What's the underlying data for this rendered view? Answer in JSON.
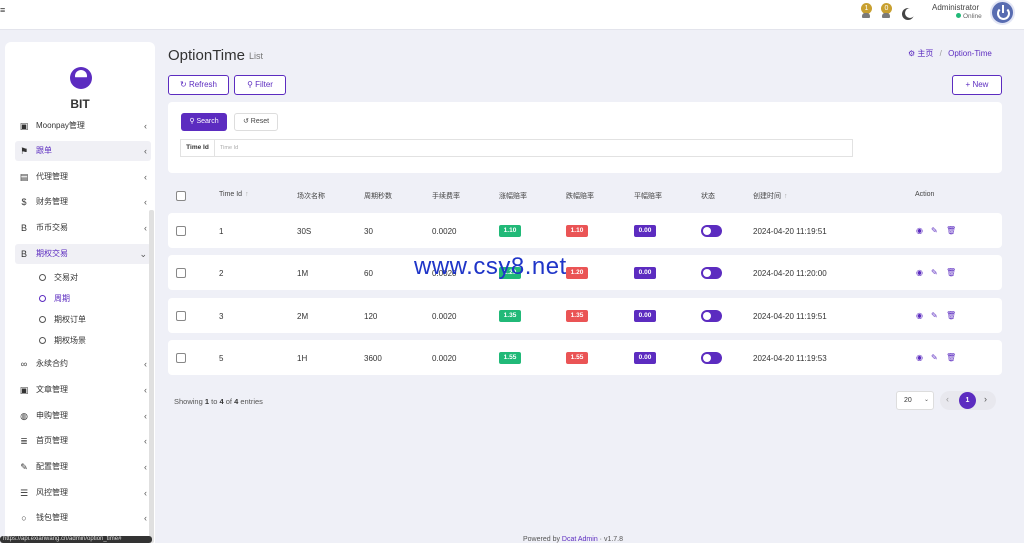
{
  "topbar": {
    "menu_icon": "hamburger-icon",
    "notif1_count": "1",
    "notif2_count": "0",
    "user_name": "Administrator",
    "user_status": "Online"
  },
  "sidebar": {
    "brand": "BIT",
    "items": [
      {
        "label": "Moonpay管理",
        "icon": "id-card-icon",
        "arrow": "‹"
      },
      {
        "label": "跟单",
        "icon": "flag-icon",
        "arrow": "‹"
      },
      {
        "label": "代理管理",
        "icon": "user-card-icon",
        "arrow": "‹"
      },
      {
        "label": "财务管理",
        "icon": "dollar-icon",
        "arrow": "‹"
      },
      {
        "label": "币币交易",
        "icon": "bitcoin-icon",
        "arrow": "‹"
      },
      {
        "label": "期权交易",
        "icon": "bitcoin-icon",
        "arrow": "⌄"
      },
      {
        "label": "永续合约",
        "icon": "link-icon",
        "arrow": "‹"
      },
      {
        "label": "文章管理",
        "icon": "id-card-icon",
        "arrow": "‹"
      },
      {
        "label": "申购管理",
        "icon": "globe-icon",
        "arrow": "‹"
      },
      {
        "label": "首页管理",
        "icon": "list-icon",
        "arrow": "‹"
      },
      {
        "label": "配置管理",
        "icon": "wrench-icon",
        "arrow": "‹"
      },
      {
        "label": "风控管理",
        "icon": "list-alt-icon",
        "arrow": "‹"
      },
      {
        "label": "钱包管理",
        "icon": "circle-icon",
        "arrow": "‹"
      }
    ],
    "subitems": [
      {
        "label": "交易对"
      },
      {
        "label": "周期"
      },
      {
        "label": "期权订单"
      },
      {
        "label": "期权场景"
      }
    ],
    "status_url": "https://api.exianwang.cn/admin/option_time#"
  },
  "page": {
    "title": "OptionTime",
    "subtitle": "List",
    "breadcrumb_home": "主页",
    "breadcrumb_sep": "/",
    "breadcrumb_current": "Option-Time"
  },
  "toolbar": {
    "refresh": "Refresh",
    "filter": "Filter",
    "new": "New"
  },
  "filter": {
    "search": "Search",
    "reset": "Reset",
    "field_label": "Time Id",
    "field_placeholder": "Time Id"
  },
  "table": {
    "headers": [
      "Time Id",
      "场次名称",
      "周期秒数",
      "手续费率",
      "涨幅赔率",
      "跌幅赔率",
      "平幅赔率",
      "状态",
      "创建时间",
      "Action"
    ],
    "rows": [
      {
        "id": "1",
        "name": "30S",
        "seconds": "30",
        "fee": "0.0020",
        "up": "1.10",
        "down": "1.10",
        "flat": "0.00",
        "status": true,
        "created": "2024-04-20 11:19:51"
      },
      {
        "id": "2",
        "name": "1M",
        "seconds": "60",
        "fee": "0.0020",
        "up": "1.20",
        "down": "1.20",
        "flat": "0.00",
        "status": true,
        "created": "2024-04-20 11:20:00"
      },
      {
        "id": "3",
        "name": "2M",
        "seconds": "120",
        "fee": "0.0020",
        "up": "1.35",
        "down": "1.35",
        "flat": "0.00",
        "status": true,
        "created": "2024-04-20 11:19:51"
      },
      {
        "id": "5",
        "name": "1H",
        "seconds": "3600",
        "fee": "0.0020",
        "up": "1.55",
        "down": "1.55",
        "flat": "0.00",
        "status": true,
        "created": "2024-04-20 11:19:53"
      }
    ]
  },
  "pagination": {
    "showing_prefix": "Showing",
    "from": "1",
    "to_word": "to",
    "to": "4",
    "of_word": "of",
    "total": "4",
    "entries_word": "entries",
    "per_page": "20",
    "current_page": "1"
  },
  "footer": {
    "powered": "Powered by",
    "link": "Dcat Admin",
    "version": "v1.7.8"
  },
  "watermark": "www.csy8.net",
  "colors": {
    "accent": "#5c2cc0",
    "green": "#21b978",
    "red": "#ea5455"
  }
}
